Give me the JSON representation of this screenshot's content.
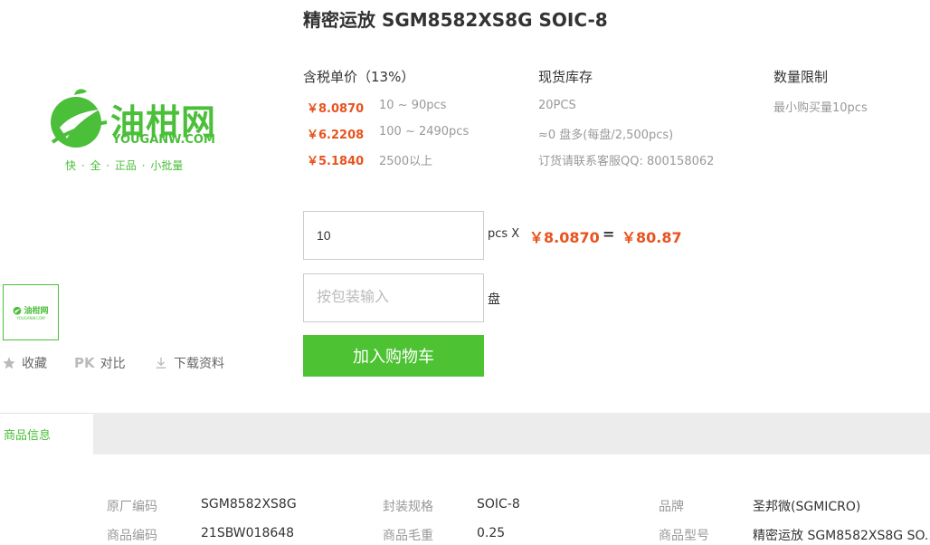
{
  "product": {
    "title": "精密运放 SGM8582XS8G SOIC-8"
  },
  "logo": {
    "name_cn": "油柑网",
    "name_en": "YOUGANW.COM",
    "slogan": "快 · 全 · 正品 · 小批量"
  },
  "pricing": {
    "header": "含税单价（13%）",
    "tiers": [
      {
        "price": "￥8.0870",
        "range": "10 ~ 90pcs"
      },
      {
        "price": "￥6.2208",
        "range": "100 ~ 2490pcs"
      },
      {
        "price": "￥5.1840",
        "range": "2500以上"
      }
    ]
  },
  "stock": {
    "header": "现货库存",
    "lines": [
      "20PCS",
      "≈0 盘多(每盘/2,500pcs)",
      "订货请联系客服QQ: 800158062"
    ]
  },
  "limit": {
    "header": "数量限制",
    "text": "最小购买量10pcs"
  },
  "order": {
    "quantity_value": "10",
    "pcs_label": "pcs X",
    "unit_price": "￥8.0870",
    "equals": "=",
    "total": "￥80.87",
    "pack_placeholder": "按包装输入",
    "pack_unit": "盘",
    "cart_label": "加入购物车"
  },
  "thumbnail": {
    "name_cn": "油柑网",
    "name_en": "YOUGANW.COM"
  },
  "actions": [
    {
      "icon": "star-icon",
      "label": "收藏"
    },
    {
      "icon": "pk-icon",
      "glyph": "PK",
      "label": "对比"
    },
    {
      "icon": "download-icon",
      "label": "下载资料"
    }
  ],
  "tabs": [
    {
      "label": "商品信息"
    }
  ],
  "specs": [
    {
      "label": "原厂编码",
      "value": "SGM8582XS8G"
    },
    {
      "label": "封装规格",
      "value": "SOIC-8"
    },
    {
      "label": "品牌",
      "value": "圣邦微(SGMICRO)"
    },
    {
      "label": "商品编码",
      "value": "21SBW018648"
    },
    {
      "label": "商品毛重",
      "value": "0.25"
    },
    {
      "label": "商品型号",
      "value": "精密运放 SGM8582XS8G SO..."
    }
  ],
  "colors": {
    "accent_green": "#4dc232",
    "price_orange": "#e8531e"
  }
}
